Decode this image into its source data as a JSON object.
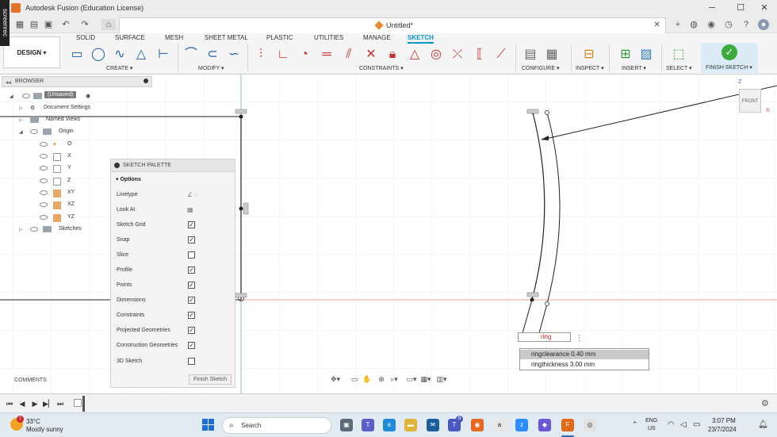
{
  "title_bar": {
    "app_title": "Autodesk Fusion (Education License)",
    "recorder_label": "screenrec",
    "minimize": "─",
    "maximize": "☐",
    "close": "✕"
  },
  "document": {
    "tab_title": "Untitled*"
  },
  "ribbon": {
    "workspace": "DESIGN ▾",
    "tabs": [
      "SOLID",
      "SURFACE",
      "MESH",
      "SHEET METAL",
      "PLASTIC",
      "UTILITIES",
      "MANAGE",
      "SKETCH"
    ],
    "active_tab": "SKETCH",
    "groups": {
      "create": "CREATE ▾",
      "modify": "MODIFY ▾",
      "constraints": "CONSTRAINTS ▾",
      "configure": "CONFIGURE ▾",
      "inspect": "INSPECT ▾",
      "insert": "INSERT ▾",
      "select": "SELECT ▾",
      "finish": "FINISH SKETCH ▾"
    }
  },
  "browser": {
    "header": "BROWSER",
    "root": "(Unsaved)",
    "items": {
      "document_settings": "Document Settings",
      "named_views": "Named Views",
      "origin": "Origin",
      "o": "O",
      "x": "X",
      "y": "Y",
      "z": "Z",
      "xy": "XY",
      "xz": "XZ",
      "yz": "YZ",
      "sketches": "Sketches"
    }
  },
  "palette": {
    "header": "SKETCH PALETTE",
    "section": "Options",
    "rows": {
      "linetype": "Linetype",
      "look_at": "Look At",
      "sketch_grid": "Sketch Grid",
      "snap": "Snap",
      "slice": "Slice",
      "profile": "Profile",
      "points": "Points",
      "dimensions": "Dimensions",
      "constraints": "Constraints",
      "projected_geometries": "Projected Geometries",
      "construction_geometries": "Construction Geometries",
      "sketch_3d": "3D Sketch"
    },
    "checked": {
      "sketch_grid": true,
      "snap": true,
      "slice": false,
      "profile": true,
      "points": true,
      "dimensions": true,
      "constraints": true,
      "projected_geometries": true,
      "construction_geometries": true,
      "sketch_3d": false
    },
    "finish_button": "Finish Sketch"
  },
  "comments": {
    "label": "COMMENTS"
  },
  "dimension": {
    "input_value": "ring",
    "suggestions": [
      {
        "name": "ringclearance",
        "value": "0.40 mm"
      },
      {
        "name": "ringthickness",
        "value": "3.00 mm"
      }
    ]
  },
  "viewcube": {
    "face": "FRONT",
    "z": "Z",
    "x": "X"
  },
  "taskbar": {
    "weather_temp": "33°C",
    "weather_desc": "Mostly sunny",
    "weather_badge": "1",
    "search": "Search",
    "lang1": "ENG",
    "lang2": "US",
    "time": "3:07 PM",
    "date": "23/7/2024",
    "teams_badge": "8"
  }
}
